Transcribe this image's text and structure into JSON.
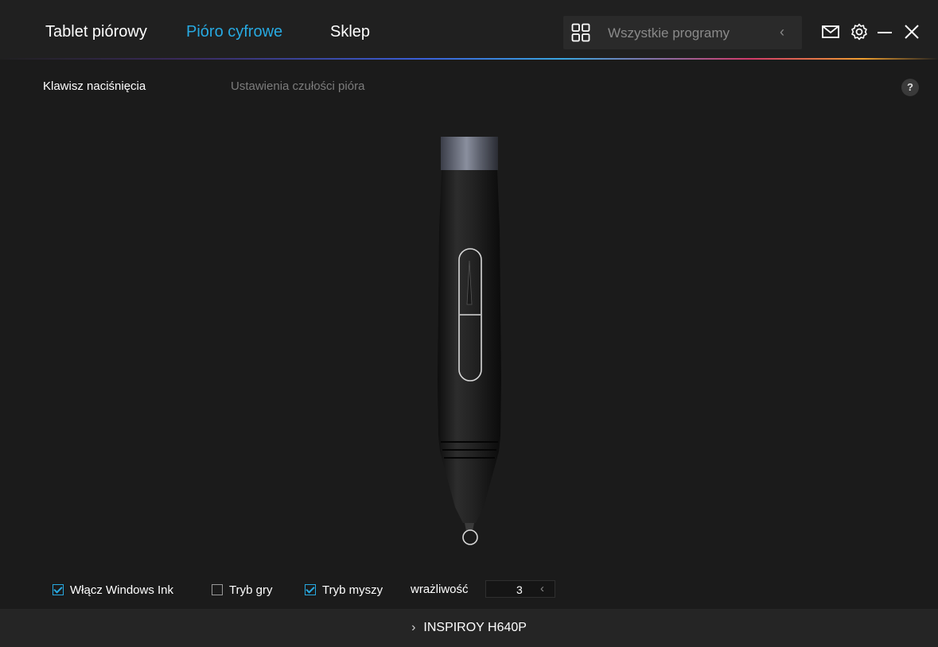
{
  "header": {
    "tabs": [
      {
        "label": "Tablet piórowy",
        "active": false
      },
      {
        "label": "Pióro cyfrowe",
        "active": true
      },
      {
        "label": "Sklep",
        "active": false
      }
    ],
    "apps_placeholder": "Wszystkie programy",
    "accent_color": "#27a9e1",
    "icons": [
      "apps-grid-icon",
      "chevron-left-icon",
      "mail-icon",
      "gear-icon",
      "minimize-icon",
      "close-icon"
    ]
  },
  "subtabs": [
    {
      "label": "Klawisz naciśnięcia",
      "active": true
    },
    {
      "label": "Ustawienia czułości pióra",
      "active": false
    }
  ],
  "help_label": "?",
  "options": {
    "windows_ink": {
      "label": "Włącz Windows Ink",
      "checked": true
    },
    "game_mode": {
      "label": "Tryb gry",
      "checked": false
    },
    "mouse_mode": {
      "label": "Tryb myszy",
      "checked": true
    },
    "sensitivity": {
      "label": "wrażliwość",
      "value": "3"
    }
  },
  "footer": {
    "device": "INSPIROY H640P"
  }
}
